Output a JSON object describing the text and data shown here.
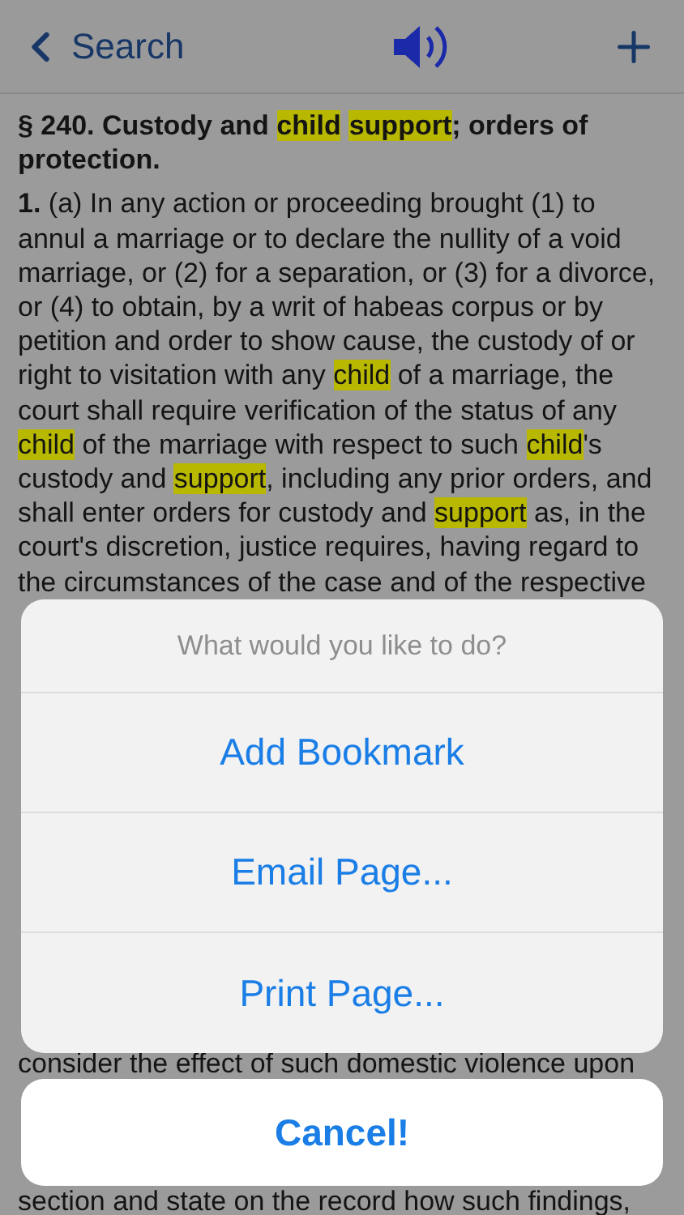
{
  "nav": {
    "back_label": "Search"
  },
  "heading": [
    {
      "text": "§ 240. Custody and ",
      "highlighted": false
    },
    {
      "text": "child",
      "highlighted": true
    },
    {
      "text": "support",
      "highlighted": true
    },
    {
      "text": "; orders of",
      "highlighted": false
    }
  ],
  "heading_line_2": "protection.",
  "lines": [
    [
      {
        "text": "**1.** (a) In any action or proceeding brought (1) to",
        "highlighted": false
      }
    ],
    [
      {
        "text": "annul a marriage or to declare the nullity of a void",
        "highlighted": false
      }
    ],
    [
      {
        "text": "marriage, or (2) for a separation, or (3) for a divorce,",
        "highlighted": false
      }
    ],
    [
      {
        "text": "or (4) to obtain, by a writ of habeas corpus or by",
        "highlighted": false
      }
    ],
    [
      {
        "text": "petition and order to show cause, the custody of or",
        "highlighted": false
      }
    ],
    [
      {
        "text": "right to visitation with any ",
        "highlighted": false
      },
      {
        "text": "child",
        "highlighted": true
      },
      {
        "text": " of a marriage, the",
        "highlighted": false
      }
    ],
    [
      {
        "text": "court shall require verification of the status of any",
        "highlighted": false
      }
    ],
    [
      {
        "text": "child",
        "highlighted": true
      },
      {
        "text": " of the marriage with respect to such ",
        "highlighted": false
      },
      {
        "text": "child",
        "highlighted": true
      },
      {
        "text": "'s",
        "highlighted": false
      }
    ],
    [
      {
        "text": "custody and ",
        "highlighted": false
      },
      {
        "text": "support",
        "highlighted": true
      },
      {
        "text": ", including any prior orders, and",
        "highlighted": false
      }
    ],
    [
      {
        "text": "shall enter orders for custody and ",
        "highlighted": false
      },
      {
        "text": "support",
        "highlighted": true
      },
      {
        "text": " as, in the",
        "highlighted": false
      }
    ],
    [
      {
        "text": "court's discretion, justice requires, having regard to",
        "highlighted": false
      }
    ],
    [
      {
        "text": "the circumstances of the case and of the respective",
        "highlighted": false
      }
    ]
  ],
  "lower_lines": [
    "consider the effect of such domestic violence upon",
    "section and state on the record how such findings,"
  ],
  "action_sheet": {
    "title": "What would you like to do?",
    "actions": [
      "Add Bookmark",
      "Email Page...",
      "Print Page..."
    ],
    "cancel": "Cancel!"
  }
}
